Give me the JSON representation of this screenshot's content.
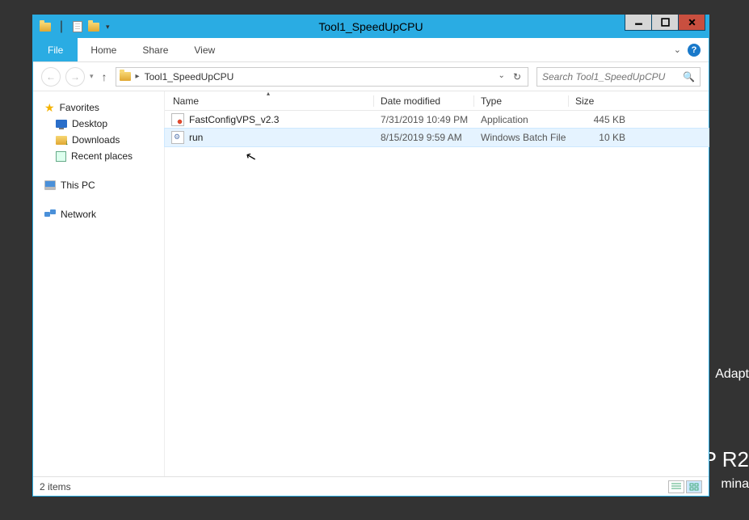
{
  "window": {
    "title": "Tool1_SpeedUpCPU"
  },
  "ribbon": {
    "file": "File",
    "tabs": [
      "Home",
      "Share",
      "View"
    ]
  },
  "nav": {
    "path_sep": "▸",
    "location": "Tool1_SpeedUpCPU",
    "search_placeholder": "Search Tool1_SpeedUpCPU"
  },
  "sidebar": {
    "favorites": {
      "label": "Favorites",
      "items": [
        "Desktop",
        "Downloads",
        "Recent places"
      ]
    },
    "thispc": "This PC",
    "network": "Network"
  },
  "columns": {
    "name": "Name",
    "date": "Date modified",
    "type": "Type",
    "size": "Size"
  },
  "files": [
    {
      "name": "FastConfigVPS_v2.3",
      "date": "7/31/2019 10:49 PM",
      "type": "Application",
      "size": "445 KB",
      "icon": "app"
    },
    {
      "name": "run",
      "date": "8/15/2019 9:59 AM",
      "type": "Windows Batch File",
      "size": "10 KB",
      "icon": "bat"
    }
  ],
  "status": {
    "count": "2 items"
  },
  "desktop_bg": {
    "line1": "Adapt",
    "line2": "P R2",
    "line3": "mina"
  }
}
